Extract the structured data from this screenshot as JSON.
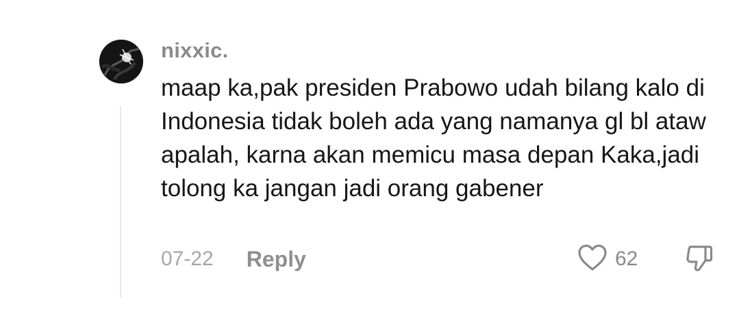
{
  "comment": {
    "username": "nixxic.",
    "text": "maap ka,pak presiden Prabowo udah bilang kalo di Indonesia tidak boleh ada yang namanya gl bl ataw apalah, karna akan memicu masa depan Kaka,jadi tolong ka jangan jadi orang gabener",
    "date": "07-22",
    "reply_label": "Reply",
    "like_count": "62",
    "like_icon": "heart-outline-icon",
    "dislike_icon": "thumbs-down-outline-icon"
  },
  "colors": {
    "username": "#8a8a8a",
    "body": "#161616",
    "meta": "#a6a6a6",
    "icon": "#8a8a8a"
  }
}
